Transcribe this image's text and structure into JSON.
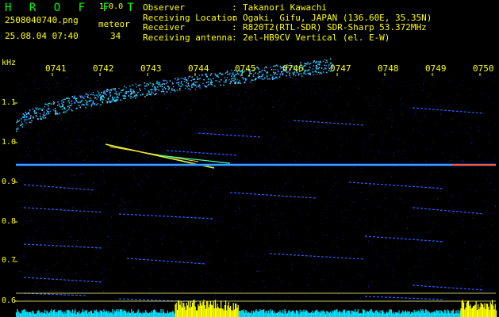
{
  "header": {
    "brand": "H R O F F T",
    "version": "1.0.0",
    "filename": "2508040740.png",
    "meteor_label": "meteor",
    "datetime": "25.08.04 07:40",
    "meteor_count": "34",
    "observer_key": "Observer",
    "observer_val": "Takanori Kawachi",
    "location_key": "Receiving Location",
    "location_val": "Ogaki, Gifu, JAPAN (136.60E, 35.35N)",
    "receiver_key": "Receiver",
    "receiver_val": "R820T2(RTL-SDR) SDR-Sharp 53.372MHz",
    "antenna_key": "Receiving antenna",
    "antenna_val": "2el-HB9CV Vertical (el. E-W)",
    "sep": ":"
  },
  "axis": {
    "unit": "kHz",
    "time_ticks": [
      "0741",
      "0742",
      "0743",
      "0744",
      "0745",
      "0746",
      "0747",
      "0748",
      "0749",
      "0750"
    ],
    "freq_ticks": [
      "1.1",
      "1.0",
      "0.9",
      "0.8",
      "0.7",
      "0.6"
    ]
  },
  "colors": {
    "text": "#ffff00",
    "brand": "#00ff00",
    "trace": "#3a7bff",
    "carrier": "#e0ff40",
    "footer_bar": "#00e5ff",
    "footer_peak": "#ffff00"
  }
}
